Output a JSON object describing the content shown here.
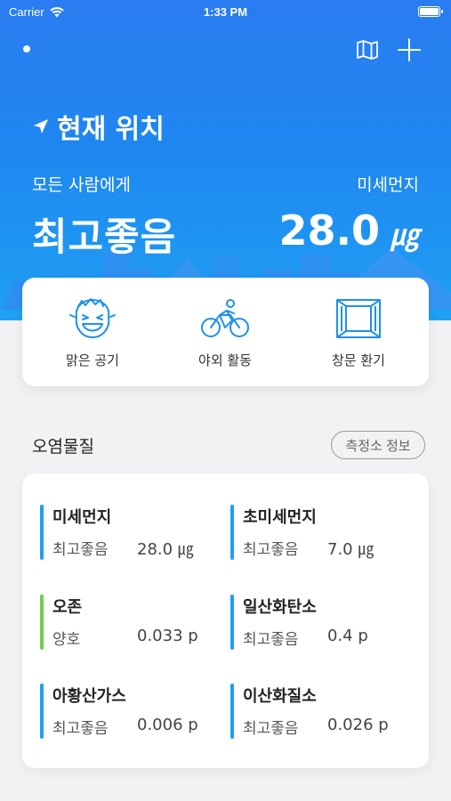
{
  "status_bar": {
    "carrier": "Carrier",
    "time": "1:33 PM"
  },
  "header": {
    "location_label": "현재 위치",
    "audience": "모든 사람에게",
    "metric_name": "미세먼지",
    "grade": "최고좋음",
    "value": "28.0",
    "unit": "㎍"
  },
  "activities": [
    {
      "label": "맑은 공기",
      "icon": "happy-face-icon"
    },
    {
      "label": "야외 활동",
      "icon": "cyclist-icon"
    },
    {
      "label": "창문 환기",
      "icon": "window-icon"
    }
  ],
  "section": {
    "title": "오염물질",
    "station_button": "측정소 정보"
  },
  "pollutants": [
    {
      "name": "미세먼지",
      "status": "최고좋음",
      "value": "28.0 ㎍",
      "color": "#1ea0f3"
    },
    {
      "name": "초미세먼지",
      "status": "최고좋음",
      "value": "7.0 ㎍",
      "color": "#1ea0f3"
    },
    {
      "name": "오존",
      "status": "양호",
      "value": "0.033 p",
      "color": "#6ad24a"
    },
    {
      "name": "일산화탄소",
      "status": "최고좋음",
      "value": "0.4 p",
      "color": "#1ea0f3"
    },
    {
      "name": "아황산가스",
      "status": "최고좋음",
      "value": "0.006 p",
      "color": "#1ea0f3"
    },
    {
      "name": "이산화질소",
      "status": "최고좋음",
      "value": "0.026 p",
      "color": "#1ea0f3"
    }
  ],
  "colors": {
    "hero_top": "#2a7cf0",
    "hero_bottom": "#1ea0f3",
    "good": "#1ea0f3",
    "fair": "#6ad24a"
  }
}
